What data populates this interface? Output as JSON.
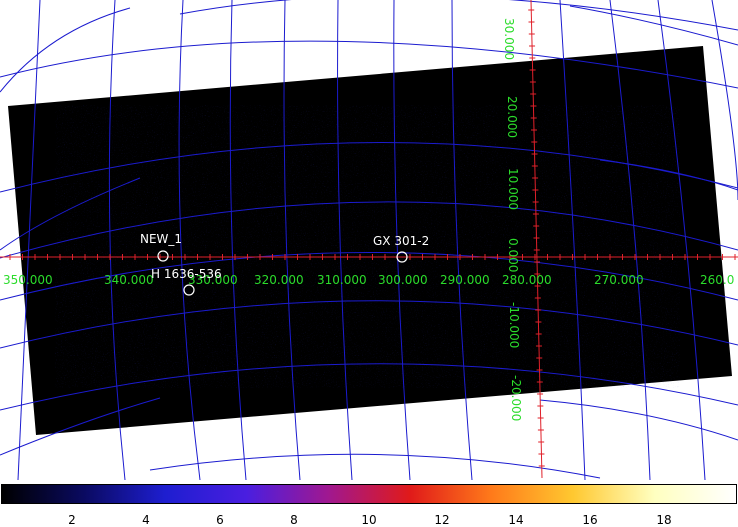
{
  "image": {
    "background_color": "#ffffff",
    "exposure_color": "#000000",
    "grid_color": "#1b1bcf",
    "crosshair_color": "#e0202a",
    "label_color": "#2bdc2b"
  },
  "longitude_labels": [
    "350.000",
    "340.000",
    "330.000",
    "320.000",
    "310.000",
    "300.000",
    "290.000",
    "280.000",
    "270.000",
    "260.0"
  ],
  "latitude_labels": [
    "30.000",
    "20.000",
    "10.000",
    "0.000",
    "-10.000",
    "-20.000"
  ],
  "sources": [
    {
      "name": "NEW_1"
    },
    {
      "name": "H 1636-536"
    },
    {
      "name": "GX 301-2"
    }
  ],
  "colorbar": {
    "ticks": [
      "2",
      "4",
      "6",
      "8",
      "10",
      "12",
      "14",
      "16",
      "18"
    ],
    "min": 0,
    "max": 20,
    "colormap": [
      "#000000",
      "#0a0a60",
      "#1e1ed0",
      "#4a1ee0",
      "#a01890",
      "#e01a1a",
      "#ff7a1a",
      "#ffc830",
      "#ffffc0",
      "#ffffff"
    ]
  }
}
